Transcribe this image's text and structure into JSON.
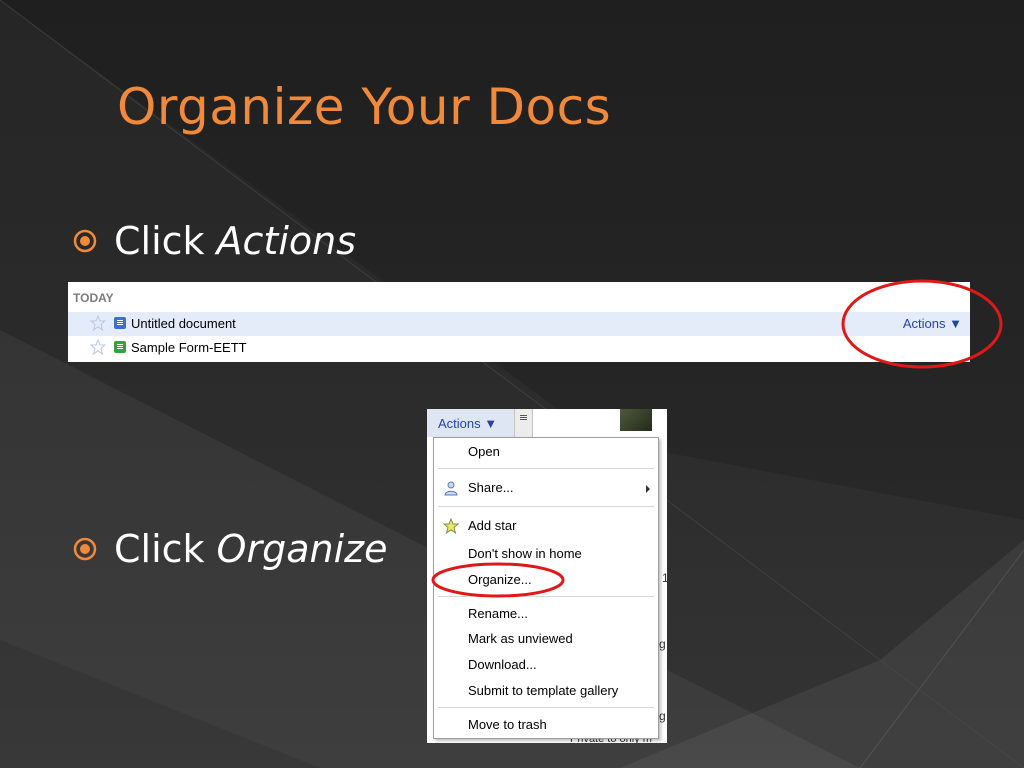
{
  "slide": {
    "title": "Organize Your Docs",
    "bullets": [
      {
        "prefix": "Click",
        "emphasis": "Actions"
      },
      {
        "prefix": "Click",
        "emphasis": "Organize"
      }
    ]
  },
  "doc_list": {
    "section_label": "TODAY",
    "rows": [
      {
        "title": "Untitled document",
        "icon": "document-icon",
        "starred": false
      },
      {
        "title": "Sample Form-EETT",
        "icon": "form-icon",
        "starred": false
      }
    ],
    "actions_label": "Actions ▼"
  },
  "menu": {
    "button_label": "Actions ▼",
    "items": [
      {
        "label": "Open"
      },
      {
        "label": "Share...",
        "icon": "share-icon",
        "has_submenu": true
      },
      {
        "label": "Add star",
        "icon": "star-icon"
      },
      {
        "label": "Don't show in home"
      },
      {
        "label": "Organize..."
      },
      {
        "label": "Rename..."
      },
      {
        "label": "Mark as unviewed"
      },
      {
        "label": "Download..."
      },
      {
        "label": "Submit to template gallery"
      },
      {
        "label": "Move to trash"
      }
    ],
    "background_fragments": [
      "1",
      "g",
      "g",
      "Private to only m"
    ]
  },
  "colors": {
    "title": "#f08a3a",
    "bullet_marker": "#f08a3a",
    "callout": "#e01818",
    "link": "#2244aa",
    "row_highlight": "#e5ecf9"
  }
}
